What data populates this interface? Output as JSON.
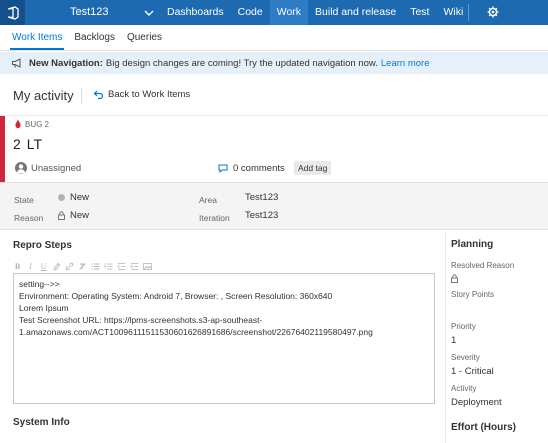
{
  "topbar": {
    "project": "Test123",
    "nav": [
      "Dashboards",
      "Code",
      "Work",
      "Build and release",
      "Test",
      "Wiki"
    ],
    "active_nav": "Work",
    "brand_color": "#1e6ab1"
  },
  "subnav": {
    "tabs": [
      "Work Items",
      "Backlogs",
      "Queries"
    ],
    "active_tab": "Work Items"
  },
  "banner": {
    "title": "New Navigation:",
    "text": "Big design changes are coming! Try the updated navigation now.",
    "link": "Learn more"
  },
  "activity": {
    "title": "My activity",
    "back": "Back to Work Items"
  },
  "work_item": {
    "type_label": "BUG 2",
    "id": "2",
    "title": "LT",
    "assigned": "Unassigned",
    "comments": "0 comments",
    "add_tag": "Add tag",
    "bug_color": "#cc293d"
  },
  "fields": {
    "state_label": "State",
    "state_value": "New",
    "reason_label": "Reason",
    "reason_value": "New",
    "area_label": "Area",
    "area_value": "Test123",
    "iteration_label": "Iteration",
    "iteration_value": "Test123"
  },
  "repro": {
    "title": "Repro Steps",
    "toolbar": [
      "bold",
      "italic",
      "underline",
      "highlight",
      "link",
      "clear-format",
      "bullets",
      "numbered",
      "outdent",
      "indent",
      "image"
    ],
    "lines": [
      "setting-->>",
      "Environment: Operating System: Android 7, Browser: , Screen Resolution: 360x640",
      "Lorem Ipsum",
      "Test Screenshot URL: https://lpms-screenshots.s3-ap-southeast-",
      "1.amazonaws.com/ACT10096111511530601626891686/screenshot/22676402119580497.png"
    ]
  },
  "system_info": {
    "title": "System Info"
  },
  "planning": {
    "title": "Planning",
    "resolved_reason_label": "Resolved Reason",
    "story_points_label": "Story Points",
    "priority_label": "Priority",
    "priority_value": "1",
    "severity_label": "Severity",
    "severity_value": "1 - Critical",
    "activity_label": "Activity",
    "activity_value": "Deployment"
  },
  "effort": {
    "title": "Effort (Hours)"
  }
}
